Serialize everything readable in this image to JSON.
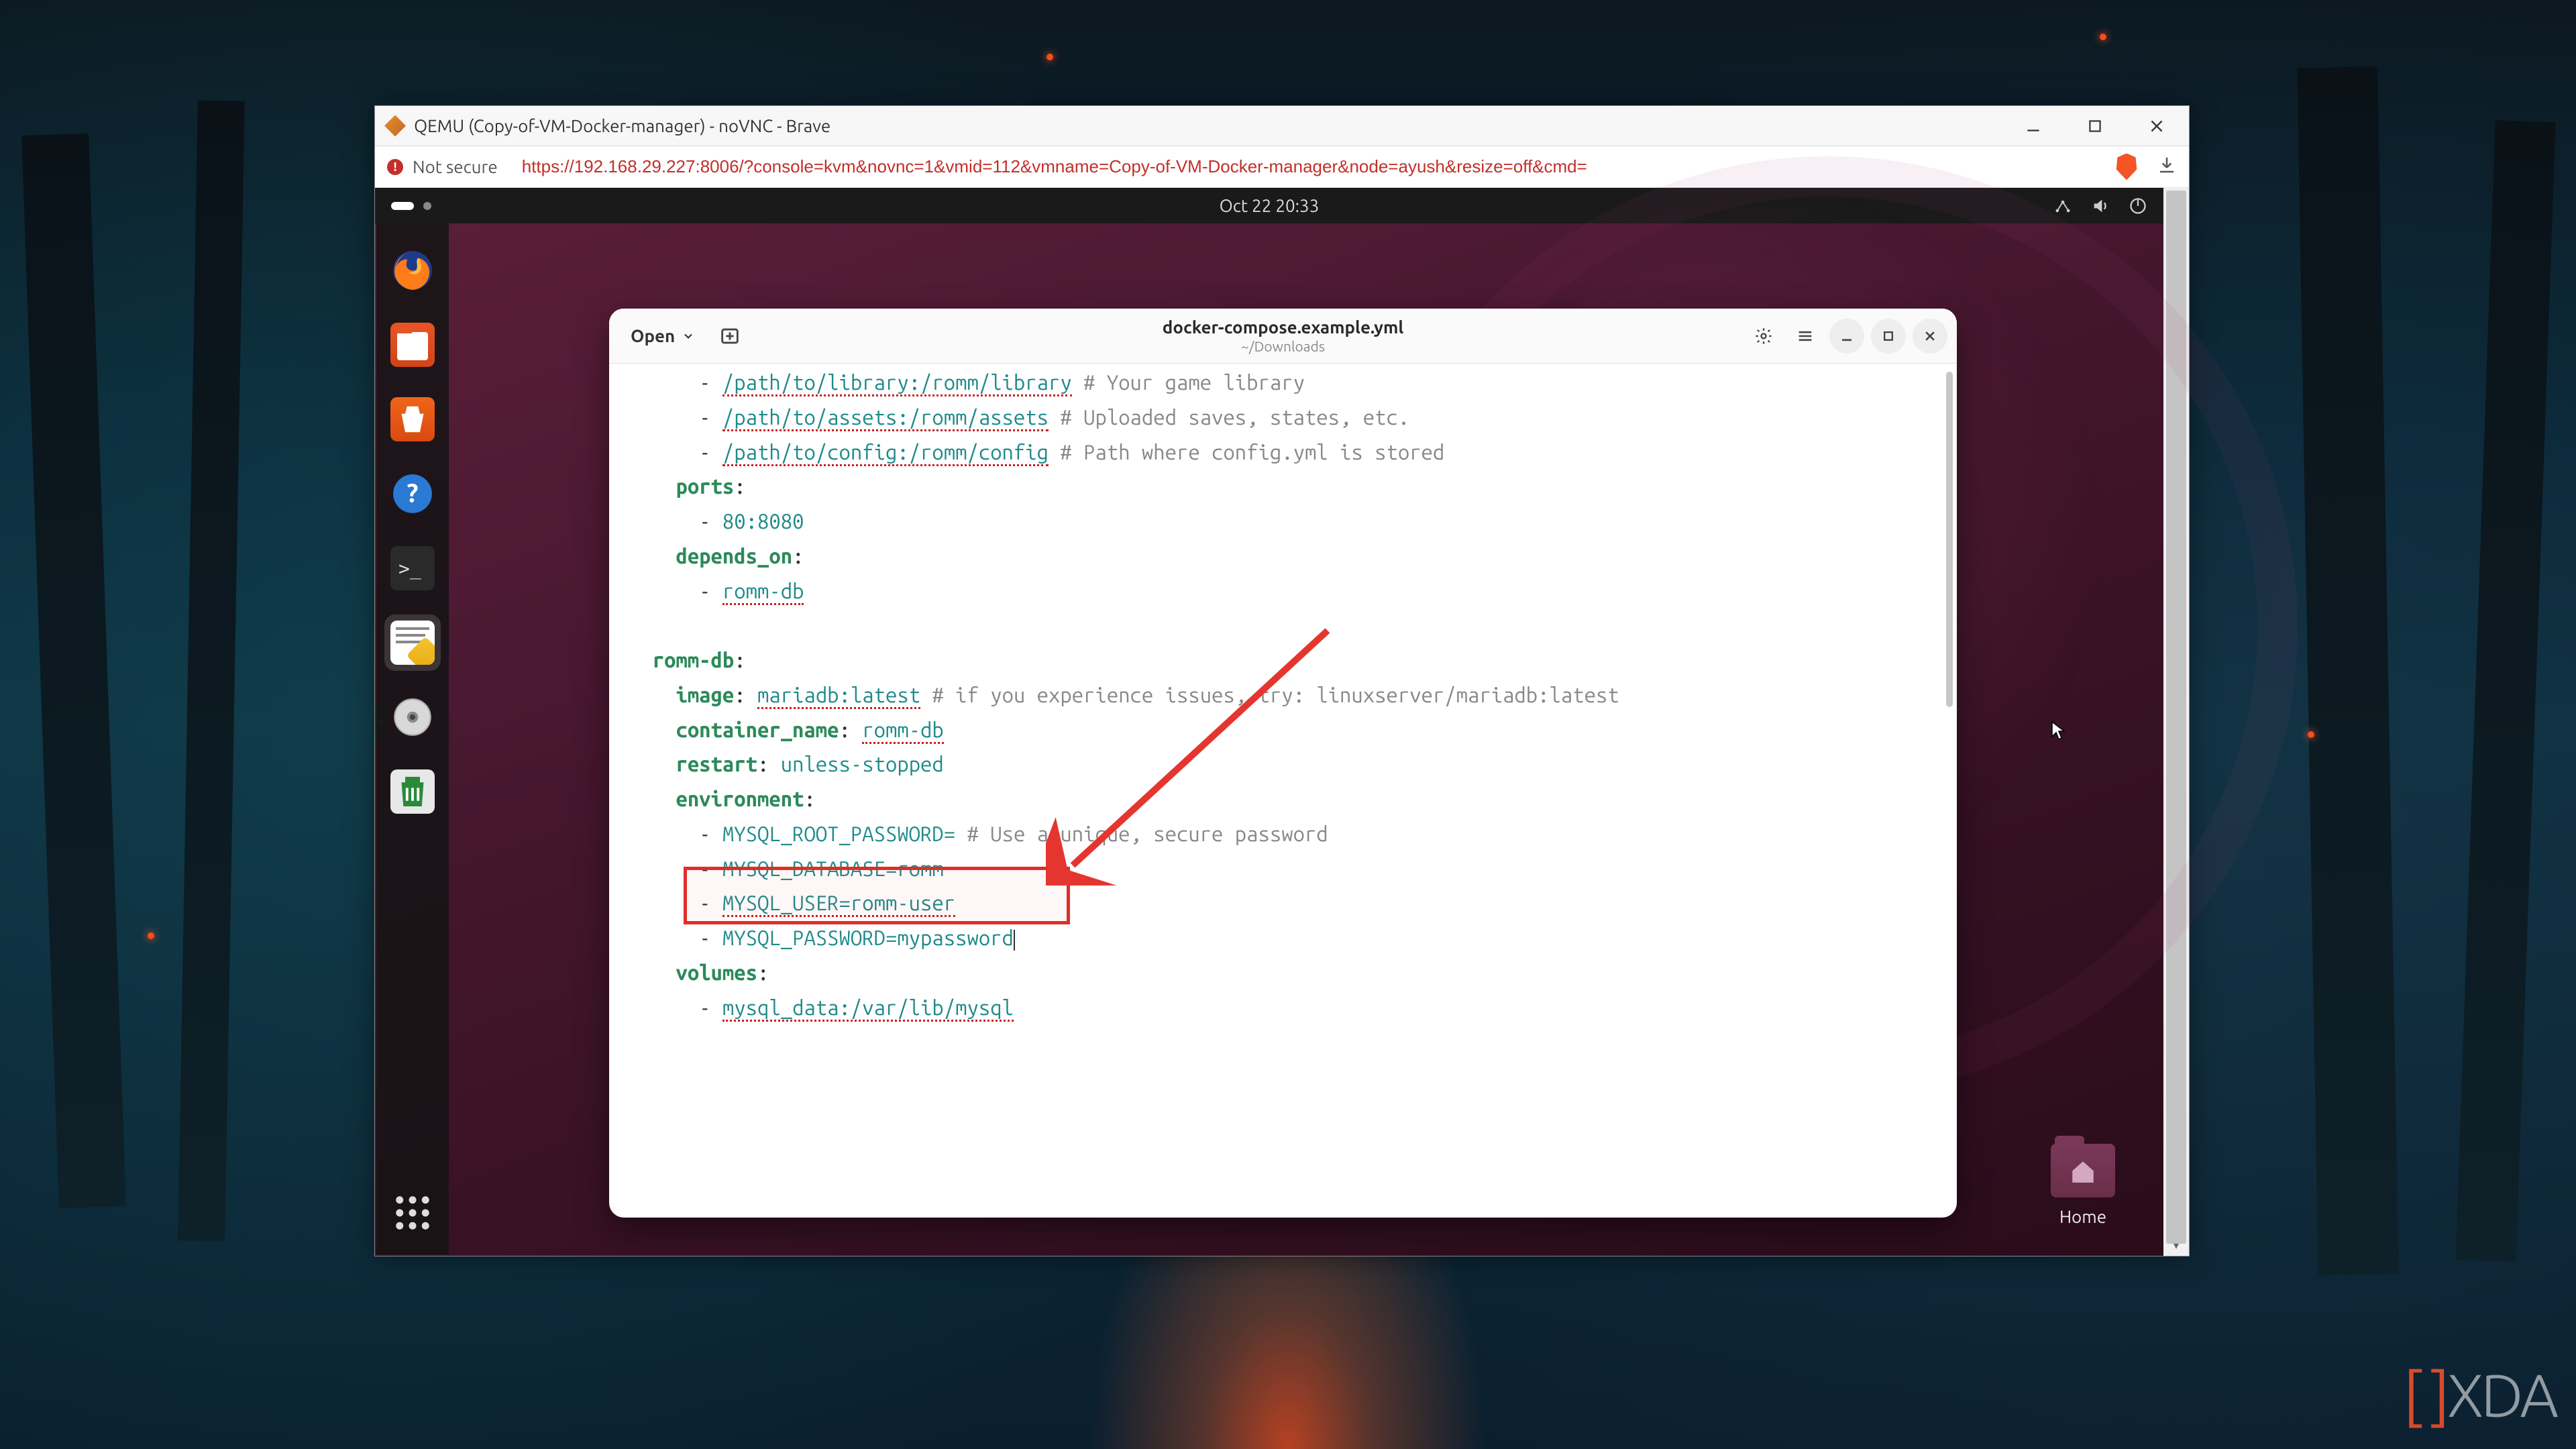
{
  "browser": {
    "title": "QEMU (Copy-of-VM-Docker-manager) - noVNC - Brave",
    "not_secure": "Not secure",
    "url": "https://192.168.29.227:8006/?console=kvm&novnc=1&vmid=112&vmname=Copy-of-VM-Docker-manager&node=ayush&resize=off&cmd="
  },
  "gnome": {
    "clock": "Oct 22  20:33",
    "home_label": "Home"
  },
  "gedit": {
    "open_label": "Open",
    "filename": "docker-compose.example.yml",
    "filepath": "~/Downloads"
  },
  "code": {
    "l1_path": "/path/to/library:/romm/library",
    "l1_cm": "# Your game library",
    "l2_path": "/path/to/assets:/romm/assets",
    "l2_cm": "# Uploaded saves, states, etc.",
    "l3_path": "/path/to/config:/romm/config",
    "l3_cm": "# Path where config.yml is stored",
    "ports": "ports",
    "ports_v": "80:8080",
    "depends": "depends_on",
    "depends_v": "romm-db",
    "svc": "romm-db",
    "image": "image",
    "image_v": "mariadb:latest",
    "image_cm": "# if you experience issues, try: linuxserver/mariadb:latest",
    "cname": "container_name",
    "cname_v": "romm-db",
    "restart": "restart",
    "restart_v": "unless-stopped",
    "env": "environment",
    "env1": "MYSQL_ROOT_PASSWORD=",
    "env1_cm": "# Use a unique, secure password",
    "env2": "MYSQL_DATABASE=romm",
    "env3": "MYSQL_USER=romm-user",
    "env4": "MYSQL_PASSWORD=mypassword",
    "vols": "volumes",
    "vols_v": "mysql_data:/var/lib/mysql"
  },
  "watermark": "XDA"
}
